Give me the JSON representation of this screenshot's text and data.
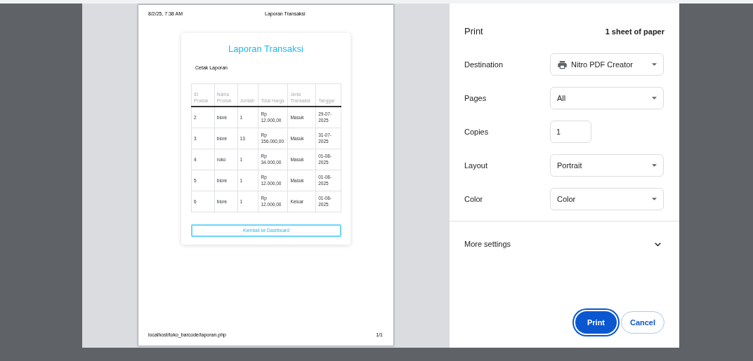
{
  "preview": {
    "header_left": "8/2/25, 7:38 AM",
    "header_title": "Laporan Transaksi",
    "card": {
      "title": "Laporan Transaksi",
      "subtitle": "Cetak Laporan",
      "table": {
        "columns": [
          "ID Produk",
          "Nama Produk",
          "Jumlah",
          "Total Harga",
          "Jenis Transaksi",
          "Tanggal"
        ],
        "rows": [
          [
            "2",
            "biore",
            "1",
            "Rp 12.000,00",
            "Masuk",
            "29-07-2025"
          ],
          [
            "3",
            "biore",
            "13",
            "Rp 156.000,00",
            "Masuk",
            "31-07-2025"
          ],
          [
            "4",
            "roko",
            "1",
            "Rp 34.000,00",
            "Masuk",
            "01-08-2025"
          ],
          [
            "5",
            "biore",
            "1",
            "Rp 12.000,00",
            "Masuk",
            "01-08-2025"
          ],
          [
            "6",
            "biore",
            "1",
            "Rp 12.000,00",
            "Keluar",
            "01-08-2025"
          ]
        ]
      },
      "back_button": "Kembali ke Dashboard"
    },
    "footer_left": "localhost/toko_barcode/laporan.php",
    "footer_right": "1/1"
  },
  "panel": {
    "title": "Print",
    "sheets": "1 sheet of paper",
    "settings": [
      {
        "kind": "select",
        "label": "Destination",
        "value": "Nitro PDF Creator"
      },
      {
        "kind": "select",
        "label": "Pages",
        "value": "All"
      },
      {
        "kind": "input",
        "label": "Copies",
        "value": "1"
      },
      {
        "kind": "select",
        "label": "Layout",
        "value": "Portrait"
      },
      {
        "kind": "select",
        "label": "Color",
        "value": "Color"
      }
    ],
    "more_settings": {
      "label": "More settings",
      "expanded": false
    },
    "buttons": [
      {
        "kind": "primary",
        "label": "Print"
      },
      {
        "kind": "secondary",
        "label": "Cancel"
      }
    ]
  }
}
